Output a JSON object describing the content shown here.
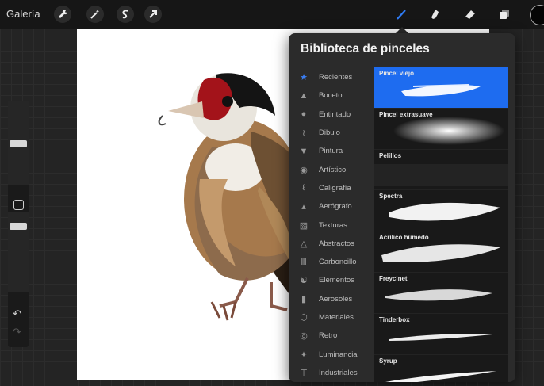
{
  "toolbar": {
    "gallery_label": "Galería",
    "left_icons": [
      "wrench-icon",
      "magic-wand-icon",
      "selection-icon",
      "transform-arrow-icon"
    ],
    "right_icons": [
      "brush-icon",
      "smudge-icon",
      "eraser-icon",
      "layers-icon",
      "color-icon"
    ],
    "active_tool": "brush"
  },
  "library": {
    "title": "Biblioteca de pinceles",
    "accent_color": "#1e6cf0",
    "sets": [
      {
        "label": "Recientes",
        "icon": "star-icon",
        "active": true
      },
      {
        "label": "Boceto",
        "icon": "pencil-tip-icon"
      },
      {
        "label": "Entintado",
        "icon": "ink-drop-icon"
      },
      {
        "label": "Dibujo",
        "icon": "squiggle-icon"
      },
      {
        "label": "Pintura",
        "icon": "paint-brush-icon"
      },
      {
        "label": "Artístico",
        "icon": "palette-icon"
      },
      {
        "label": "Caligrafía",
        "icon": "calligraphy-icon"
      },
      {
        "label": "Aerógrafo",
        "icon": "airbrush-icon"
      },
      {
        "label": "Texturas",
        "icon": "texture-icon"
      },
      {
        "label": "Abstractos",
        "icon": "triangle-icon"
      },
      {
        "label": "Carboncillo",
        "icon": "charcoal-icon"
      },
      {
        "label": "Elementos",
        "icon": "yin-yang-icon"
      },
      {
        "label": "Aerosoles",
        "icon": "spray-can-icon"
      },
      {
        "label": "Materiales",
        "icon": "cube-icon"
      },
      {
        "label": "Retro",
        "icon": "retro-icon"
      },
      {
        "label": "Luminancia",
        "icon": "sparkle-icon"
      },
      {
        "label": "Industriales",
        "icon": "anvil-icon"
      }
    ],
    "brushes": [
      {
        "name": "Pincel viejo",
        "selected": true
      },
      {
        "name": "Pincel extrasuave"
      },
      {
        "name": "Pelillos"
      },
      {
        "name": "Spectra"
      },
      {
        "name": "Acrílico húmedo"
      },
      {
        "name": "Freycinet"
      },
      {
        "name": "Tinderbox"
      },
      {
        "name": "Syrup"
      }
    ]
  },
  "sidebar": {
    "brush_size_level": 0.55,
    "opacity_level": 0.7
  }
}
